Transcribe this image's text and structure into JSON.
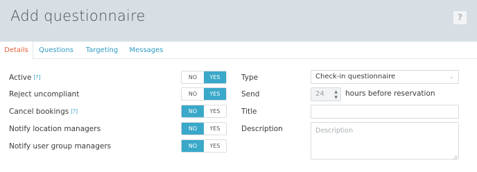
{
  "header": {
    "title": "Add questionnaire",
    "help_label": "?"
  },
  "tabs": [
    {
      "label": "Details",
      "active": true
    },
    {
      "label": "Questions",
      "active": false
    },
    {
      "label": "Targeting",
      "active": false
    },
    {
      "label": "Messages",
      "active": false
    }
  ],
  "settings": [
    {
      "label": "Active",
      "tip": "[?]",
      "no": "NO",
      "yes": "YES",
      "selected": "YES"
    },
    {
      "label": "Reject uncompliant",
      "tip": "",
      "no": "NO",
      "yes": "YES",
      "selected": "YES"
    },
    {
      "label": "Cancel bookings",
      "tip": "[?]",
      "no": "NO",
      "yes": "YES",
      "selected": "NO"
    },
    {
      "label": "Notify location managers",
      "tip": "",
      "no": "NO",
      "yes": "YES",
      "selected": "NO"
    },
    {
      "label": "Notify user group managers",
      "tip": "",
      "no": "NO",
      "yes": "YES",
      "selected": "NO"
    }
  ],
  "form": {
    "type_label": "Type",
    "type_value": "Check-in questionnaire",
    "send_label": "Send",
    "send_value": "24",
    "send_suffix": "hours before reservation",
    "title_label": "Title",
    "title_value": "",
    "description_label": "Description",
    "description_placeholder": "Description"
  },
  "colors": {
    "accent": "#3aa8c9",
    "active_tab": "#e3603a",
    "link": "#2e9bc4",
    "header_bg": "#d7dfe4"
  }
}
